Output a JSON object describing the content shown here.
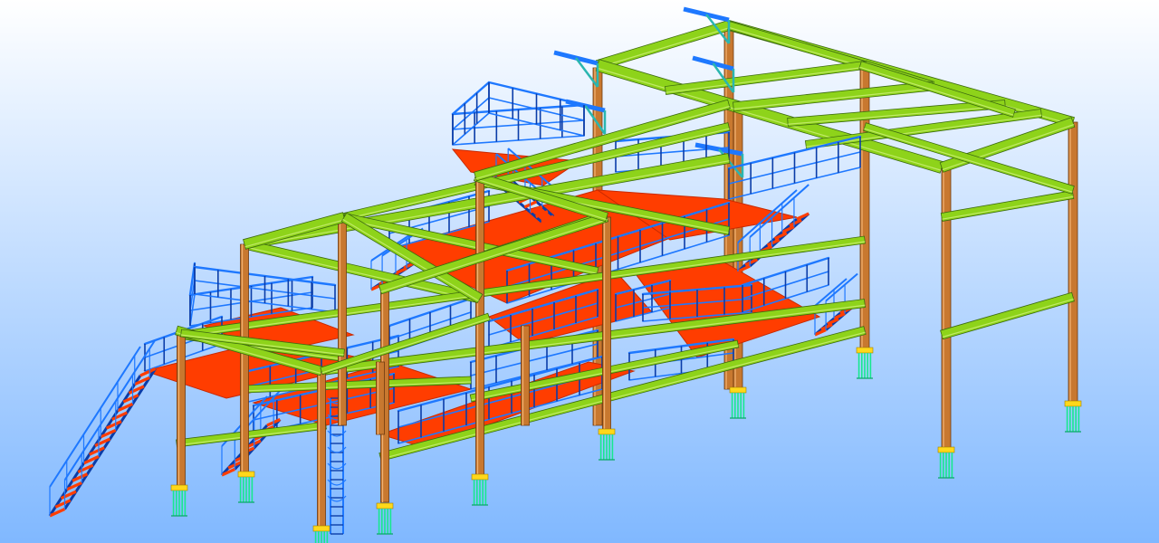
{
  "viewport": {
    "background_top": "#ffffff",
    "background_bottom": "#80b8ff"
  },
  "colors": {
    "beam_green": "#8ed31a",
    "beam_green_dark": "#3c6a10",
    "beam_green_light": "#cdf07a",
    "column_orange": "#c8782f",
    "column_orange_dark": "#6e3a10",
    "column_orange_light": "#f0b070",
    "deck_red": "#ff3d00",
    "deck_red_dark": "#c82a00",
    "rail_blue": "#1e78ff",
    "rail_blue_dark": "#0a3ca8",
    "base_green": "#18e890",
    "base_yellow": "#ffd81a",
    "bracket_teal": "#2ab6b0"
  },
  "scene": {
    "model": "steel-structure-3d",
    "elements": [
      "columns",
      "beams",
      "platform-decks",
      "handrails",
      "stairs",
      "ladder",
      "column-baseplates",
      "cantilever-brackets"
    ]
  }
}
